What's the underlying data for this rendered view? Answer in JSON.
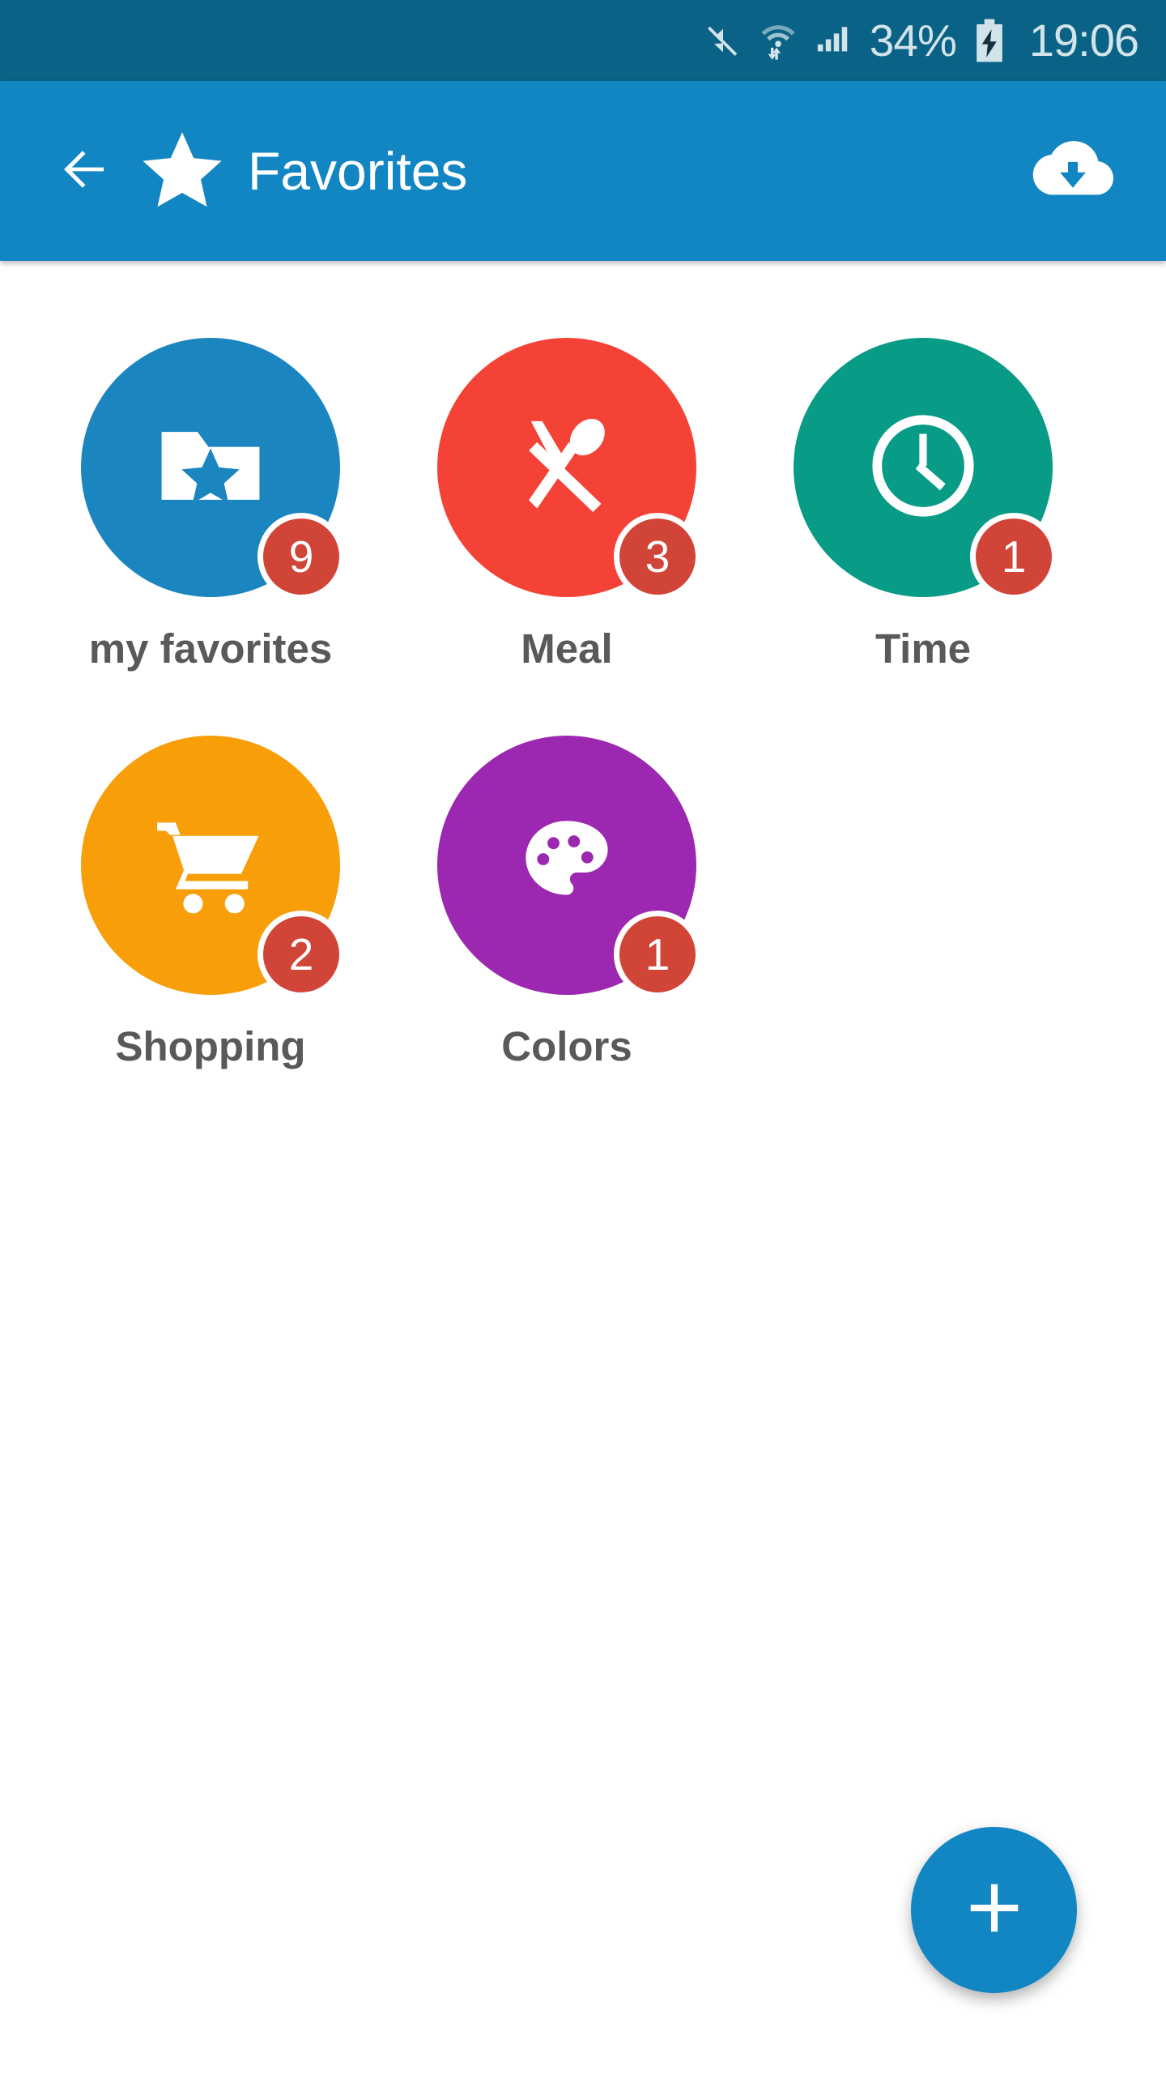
{
  "status_bar": {
    "icons": [
      "mute-icon",
      "wifi-transfer-icon",
      "signal-bars-icon"
    ],
    "battery_percent": "34%",
    "battery_icon": "battery-charging-icon",
    "clock": "19:06",
    "background_color": "#0a6286",
    "text_color": "#d3e3ea"
  },
  "app_bar": {
    "back_icon": "back-arrow-icon",
    "brand_icon": "star-icon",
    "title": "Favorites",
    "action_icon": "cloud-download-icon",
    "background_color": "#1286c3",
    "text_color": "#ffffff"
  },
  "grid": {
    "items": [
      {
        "label": "my favorites",
        "icon": "folder-star-icon",
        "badge": "9",
        "color": "#1b85c0"
      },
      {
        "label": "Meal",
        "icon": "knife-spoon-icon",
        "badge": "3",
        "color": "#f44336"
      },
      {
        "label": "Time",
        "icon": "clock-icon",
        "badge": "1",
        "color": "#089b86"
      },
      {
        "label": "Shopping",
        "icon": "shopping-cart-icon",
        "badge": "2",
        "color": "#f79e09"
      },
      {
        "label": "Colors",
        "icon": "palette-icon",
        "badge": "1",
        "color": "#9c27b0"
      }
    ],
    "badge_color": "#d14438",
    "label_color": "#595959"
  },
  "fab": {
    "icon": "plus-icon",
    "color": "#1286c3"
  }
}
